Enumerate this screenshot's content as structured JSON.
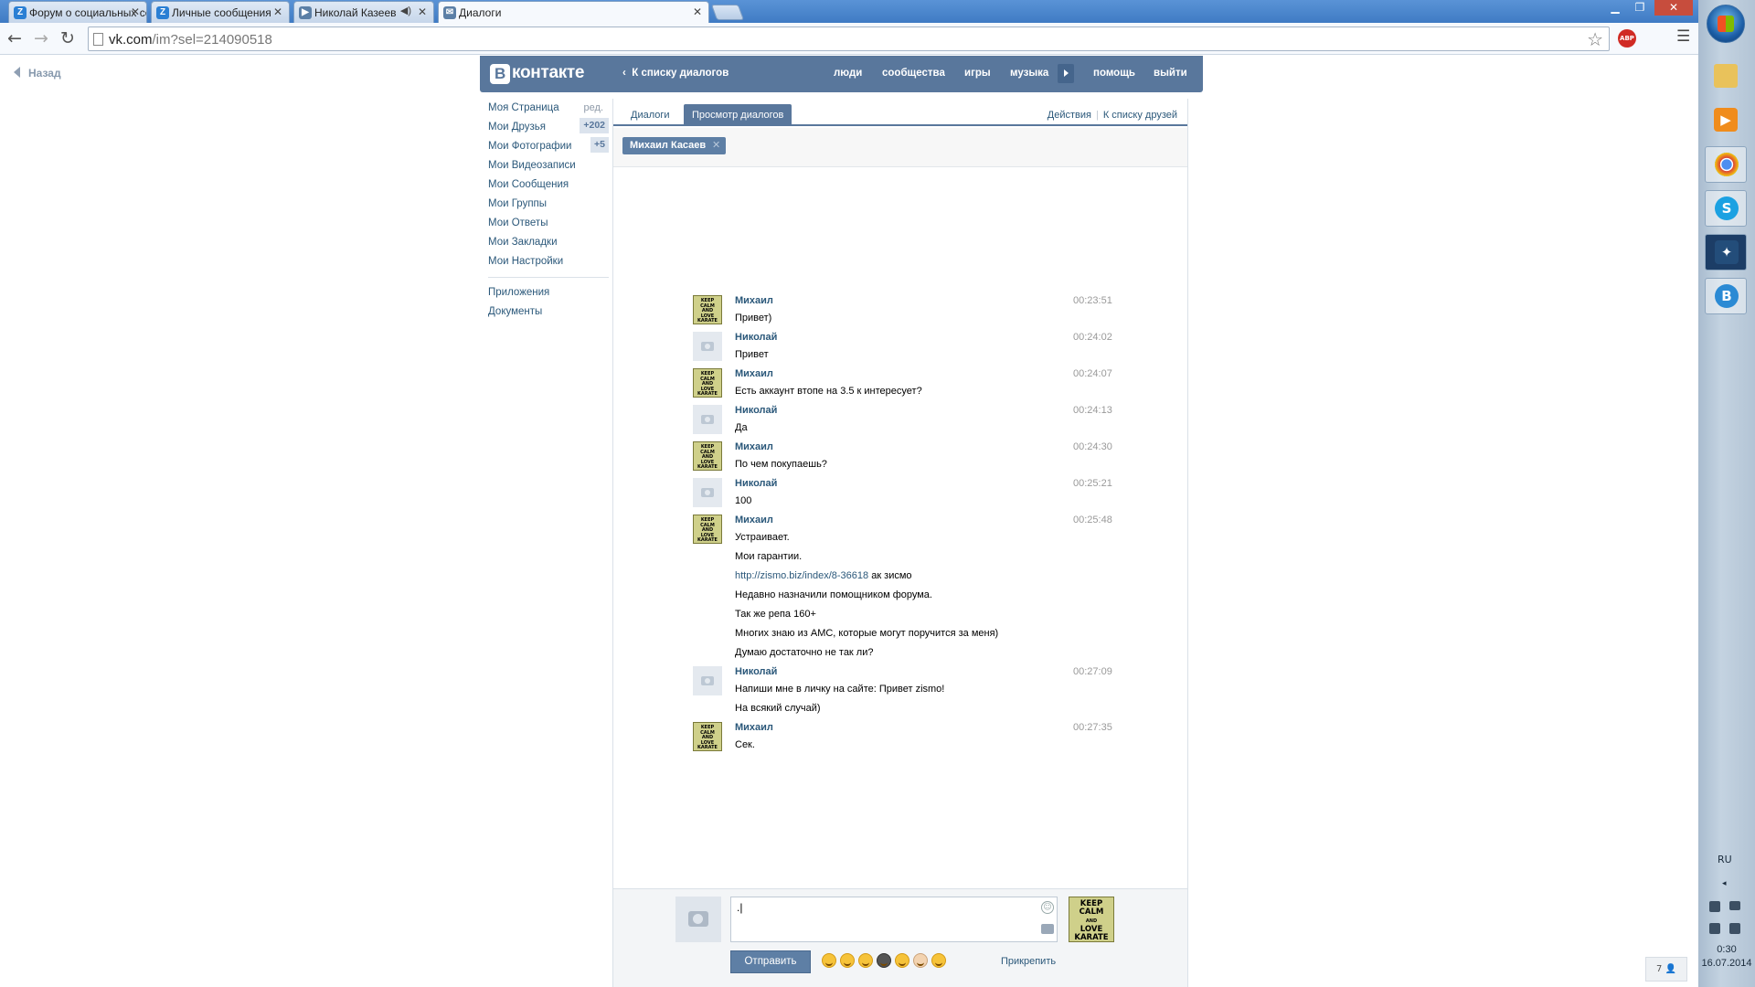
{
  "browser": {
    "tabs": [
      {
        "title": "Форум о социальных сет",
        "favicon": "Z",
        "favicon_color": "#2a7fd4"
      },
      {
        "title": "Личные сообщения",
        "favicon": "Z",
        "favicon_color": "#2a7fd4"
      },
      {
        "title": "Николай Казеев",
        "favicon": "vk",
        "favicon_color": "#5b7fa6"
      },
      {
        "title": "Диалоги",
        "favicon": "vk",
        "favicon_color": "#5b7fa6"
      }
    ],
    "url_host": "vk.com",
    "url_path": "/im?sel=214090518",
    "abp_label": "ABP"
  },
  "page": {
    "back_label": "Назад"
  },
  "vk_header": {
    "logo": "контакте",
    "logo_letter": "B",
    "back_to_list": "К списку диалогов",
    "nav": [
      "люди",
      "сообщества",
      "игры",
      "музыка",
      "помощь",
      "выйти"
    ]
  },
  "left_menu": {
    "items": [
      {
        "label": "Моя Страница",
        "extra": "ред."
      },
      {
        "label": "Мои Друзья",
        "badge": "+202"
      },
      {
        "label": "Мои Фотографии",
        "badge": "+5"
      },
      {
        "label": "Мои Видеозаписи"
      },
      {
        "label": "Мои Сообщения"
      },
      {
        "label": "Мои Группы"
      },
      {
        "label": "Мои Ответы"
      },
      {
        "label": "Мои Закладки"
      },
      {
        "label": "Мои Настройки"
      }
    ],
    "extra_items": [
      "Приложения",
      "Документы"
    ]
  },
  "dialog": {
    "tabs": [
      "Диалоги",
      "Просмотр диалогов"
    ],
    "actions": "Действия",
    "friends_link": "К списку друзей",
    "peer_chip": "Михаил Касаев"
  },
  "messages": [
    {
      "author": "Михаил",
      "avatar": "keep-calm",
      "time": "00:23:51",
      "lines": [
        "Привет)"
      ]
    },
    {
      "author": "Николай",
      "avatar": "camera",
      "time": "00:24:02",
      "lines": [
        "Привет"
      ]
    },
    {
      "author": "Михаил",
      "avatar": "keep-calm",
      "time": "00:24:07",
      "lines": [
        "Есть аккаунт втопе на 3.5 к интересует?"
      ]
    },
    {
      "author": "Николай",
      "avatar": "camera",
      "time": "00:24:13",
      "lines": [
        "Да"
      ]
    },
    {
      "author": "Михаил",
      "avatar": "keep-calm",
      "time": "00:24:30",
      "lines": [
        "По чем покупаешь?"
      ]
    },
    {
      "author": "Николай",
      "avatar": "camera",
      "time": "00:25:21",
      "lines": [
        "100"
      ]
    },
    {
      "author": "Михаил",
      "avatar": "keep-calm",
      "time": "00:25:48",
      "lines": [
        "Устраивает.",
        "Мои гарантии.",
        "LINK",
        "Недавно назначили помощником форума.",
        "Так же репа 160+",
        "Многих знаю из АМС, которые могут поручится за меня)",
        "Думаю достаточно не так ли?"
      ]
    },
    {
      "author": "Николай",
      "avatar": "camera",
      "time": "00:27:09",
      "lines": [
        "Напиши мне в личку на сайте: Привет zismo!",
        "На всякий случай)"
      ]
    },
    {
      "author": "Михаил",
      "avatar": "keep-calm",
      "time": "00:27:35",
      "lines": [
        "Сек."
      ]
    }
  ],
  "guarantee_link": {
    "url": "http://zismo.biz/index/8-36618",
    "suffix": " ак зисмо"
  },
  "avatar_text": [
    "KEEP",
    "CALM",
    "AND",
    "LOVE",
    "KARATE"
  ],
  "composer": {
    "input_value": ".|",
    "send_label": "Отправить",
    "attach_label": "Прикрепить"
  },
  "corner_badge": "7",
  "taskbar": {
    "lang": "RU",
    "time": "0:30",
    "date": "16.07.2014",
    "apps": [
      "folder-icon",
      "media-player-icon",
      "chrome-icon",
      "skype-icon",
      "app-icon",
      "vk-icon"
    ]
  },
  "colors": {
    "vk_blue": "#59779c",
    "link": "#2b587a"
  }
}
